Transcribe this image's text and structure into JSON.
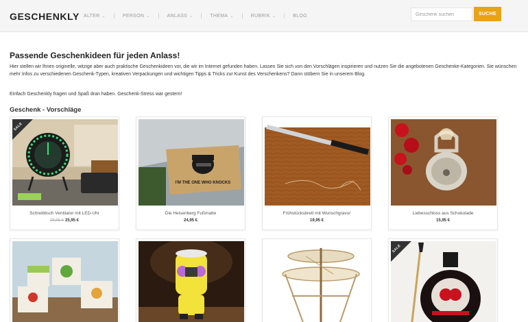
{
  "header": {
    "logo": "GESCHENKLY",
    "nav": [
      "ALTER",
      "PERSON",
      "ANLASS",
      "THEMA",
      "RUBRIK",
      "BLOG"
    ],
    "search_placeholder": "Geschenk suchen",
    "search_button": "SUCHE"
  },
  "intro": {
    "heading": "Passende Geschenkideen für jeden Anlass!",
    "paragraph1": "Hier stellen wir Ihnen originelle, witzige aber auch praktische Geschenkideen vor, die wir im Internet gefunden haben. Lassen Sie sich von den Vorschlägen inspirieren und nutzen Sie die angebotenen Geschenke-Kategorien. Sie wünschen mehr Infos zu verschiedenen Geschenk-Typen, kreativen Verpackungen und wichtigen Tipps & Tricks zur Kunst des Verschenkens? Dann stöbern Sie in unserem Blog.",
    "paragraph2": "Einfach Geschenkly fragen und Spaß dran haben. Geschenk-Stress war gestern!",
    "suggestions_heading": "Geschenk - Vorschläge"
  },
  "products": [
    {
      "title": "Schreibtisch Ventilator mit LED-Uhr",
      "old_price": "29,95 €",
      "price": "25,95 €",
      "sale": "SALE"
    },
    {
      "title": "Die Heisenberg Fußmatte",
      "old_price": "",
      "price": "24,95 €",
      "sale": "",
      "mat_text": "I'M THE ONE WHO KNOCKS"
    },
    {
      "title": "Frühstücksbrett mit Wunschgravur",
      "old_price": "",
      "price": "19,95 €",
      "sale": ""
    },
    {
      "title": "Liebesschloss aus Schokolade",
      "old_price": "",
      "price": "15,95 €",
      "sale": ""
    },
    {
      "title": "",
      "old_price": "",
      "price": "",
      "sale": ""
    },
    {
      "title": "",
      "old_price": "",
      "price": "",
      "sale": ""
    },
    {
      "title": "",
      "old_price": "",
      "price": "",
      "sale": ""
    },
    {
      "title": "",
      "old_price": "",
      "price": "",
      "sale": "SALE"
    }
  ],
  "colors": {
    "accent": "#e8a317",
    "header_bg": "#f5f5f5",
    "sale_badge": "#333333"
  }
}
